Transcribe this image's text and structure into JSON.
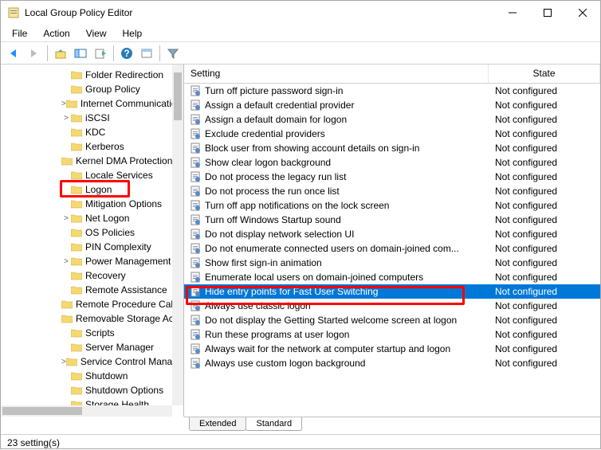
{
  "window": {
    "title": "Local Group Policy Editor"
  },
  "menu": {
    "file": "File",
    "action": "Action",
    "view": "View",
    "help": "Help"
  },
  "tree": {
    "items": [
      {
        "label": "Folder Redirection",
        "indent": 90,
        "exp": ""
      },
      {
        "label": "Group Policy",
        "indent": 90,
        "exp": ""
      },
      {
        "label": "Internet Communication Management",
        "indent": 90,
        "exp": ">"
      },
      {
        "label": "iSCSI",
        "indent": 90,
        "exp": ">"
      },
      {
        "label": "KDC",
        "indent": 90,
        "exp": ""
      },
      {
        "label": "Kerberos",
        "indent": 90,
        "exp": ""
      },
      {
        "label": "Kernel DMA Protection",
        "indent": 90,
        "exp": ""
      },
      {
        "label": "Locale Services",
        "indent": 90,
        "exp": ""
      },
      {
        "label": "Logon",
        "indent": 90,
        "exp": ""
      },
      {
        "label": "Mitigation Options",
        "indent": 90,
        "exp": ""
      },
      {
        "label": "Net Logon",
        "indent": 90,
        "exp": ">"
      },
      {
        "label": "OS Policies",
        "indent": 90,
        "exp": ""
      },
      {
        "label": "PIN Complexity",
        "indent": 90,
        "exp": ""
      },
      {
        "label": "Power Management",
        "indent": 90,
        "exp": ">"
      },
      {
        "label": "Recovery",
        "indent": 90,
        "exp": ""
      },
      {
        "label": "Remote Assistance",
        "indent": 90,
        "exp": ""
      },
      {
        "label": "Remote Procedure Call",
        "indent": 90,
        "exp": ""
      },
      {
        "label": "Removable Storage Access",
        "indent": 90,
        "exp": ""
      },
      {
        "label": "Scripts",
        "indent": 90,
        "exp": ""
      },
      {
        "label": "Server Manager",
        "indent": 90,
        "exp": ""
      },
      {
        "label": "Service Control Manager Settings",
        "indent": 90,
        "exp": ">"
      },
      {
        "label": "Shutdown",
        "indent": 90,
        "exp": ""
      },
      {
        "label": "Shutdown Options",
        "indent": 90,
        "exp": ""
      },
      {
        "label": "Storage Health",
        "indent": 90,
        "exp": ""
      }
    ]
  },
  "columns": {
    "setting": "Setting",
    "state": "State"
  },
  "settings": [
    {
      "name": "Turn off picture password sign-in",
      "state": "Not configured"
    },
    {
      "name": "Assign a default credential provider",
      "state": "Not configured"
    },
    {
      "name": "Assign a default domain for logon",
      "state": "Not configured"
    },
    {
      "name": "Exclude credential providers",
      "state": "Not configured"
    },
    {
      "name": "Block user from showing account details on sign-in",
      "state": "Not configured"
    },
    {
      "name": "Show clear logon background",
      "state": "Not configured"
    },
    {
      "name": "Do not process the legacy run list",
      "state": "Not configured"
    },
    {
      "name": "Do not process the run once list",
      "state": "Not configured"
    },
    {
      "name": "Turn off app notifications on the lock screen",
      "state": "Not configured"
    },
    {
      "name": "Turn off Windows Startup sound",
      "state": "Not configured"
    },
    {
      "name": "Do not display network selection UI",
      "state": "Not configured"
    },
    {
      "name": "Do not enumerate connected users on domain-joined com...",
      "state": "Not configured"
    },
    {
      "name": "Show first sign-in animation",
      "state": "Not configured"
    },
    {
      "name": "Enumerate local users on domain-joined computers",
      "state": "Not configured"
    },
    {
      "name": "Hide entry points for Fast User Switching",
      "state": "Not configured",
      "selected": true
    },
    {
      "name": "Always use classic logon",
      "state": "Not configured"
    },
    {
      "name": "Do not display the Getting Started welcome screen at logon",
      "state": "Not configured"
    },
    {
      "name": "Run these programs at user logon",
      "state": "Not configured"
    },
    {
      "name": "Always wait for the network at computer startup and logon",
      "state": "Not configured"
    },
    {
      "name": "Always use custom logon background",
      "state": "Not configured"
    }
  ],
  "tabs": {
    "extended": "Extended",
    "standard": "Standard"
  },
  "status": "23 setting(s)"
}
